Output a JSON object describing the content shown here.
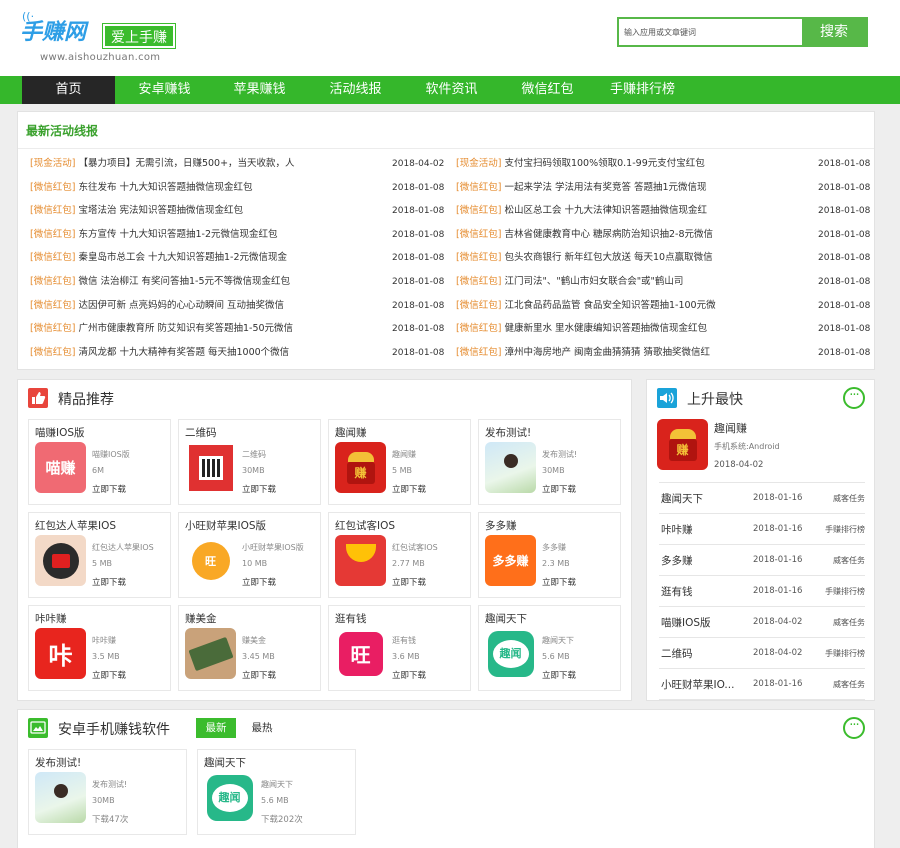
{
  "header": {
    "logo_text": "手赚网",
    "logo_tag": "爱上手赚",
    "logo_url": "www.aishouzhuan.com",
    "search_placeholder": "输入应用或文章键词",
    "search_button": "搜索"
  },
  "nav": [
    "首页",
    "安卓赚钱",
    "苹果赚钱",
    "活动线报",
    "软件资讯",
    "微信红包",
    "手赚排行榜"
  ],
  "news": {
    "title": "最新活动线报",
    "left": [
      {
        "cat": "[现金活动]",
        "text": "【暴力项目】无需引流，日赚500+，当天收款，人",
        "date": "2018-04-02"
      },
      {
        "cat": "[微信红包]",
        "text": "东往发布 十九大知识答题抽微信现金红包",
        "date": "2018-01-08"
      },
      {
        "cat": "[微信红包]",
        "text": "宝塔法治 宪法知识答题抽微信现金红包",
        "date": "2018-01-08"
      },
      {
        "cat": "[微信红包]",
        "text": "东方宣传 十九大知识答题抽1-2元微信现金红包",
        "date": "2018-01-08"
      },
      {
        "cat": "[微信红包]",
        "text": "秦皇岛市总工会 十九大知识答题抽1-2元微信现金",
        "date": "2018-01-08"
      },
      {
        "cat": "[微信红包]",
        "text": "微信 法治柳江 有奖问答抽1-5元不等微信现金红包",
        "date": "2018-01-08"
      },
      {
        "cat": "[微信红包]",
        "text": "达因伊可新 点亮妈妈的心心动瞬间 互动抽奖微信",
        "date": "2018-01-08"
      },
      {
        "cat": "[微信红包]",
        "text": "广州市健康教育所 防艾知识有奖答题抽1-50元微信",
        "date": "2018-01-08"
      },
      {
        "cat": "[微信红包]",
        "text": "清风龙都 十九大精神有奖答题 每天抽1000个微信",
        "date": "2018-01-08"
      }
    ],
    "right": [
      {
        "cat": "[现金活动]",
        "text": "支付宝扫码领取100%领取0.1-99元支付宝红包",
        "date": "2018-01-08"
      },
      {
        "cat": "[微信红包]",
        "text": "一起来学法 学法用法有奖竞答 答题抽1元微信现",
        "date": "2018-01-08"
      },
      {
        "cat": "[微信红包]",
        "text": "松山区总工会 十九大法律知识答题抽微信现金红",
        "date": "2018-01-08"
      },
      {
        "cat": "[微信红包]",
        "text": "吉林省健康教育中心 糖尿病防治知识抽2-8元微信",
        "date": "2018-01-08"
      },
      {
        "cat": "[微信红包]",
        "text": "包头农商银行 新年红包大放送 每天10点赢取微信",
        "date": "2018-01-08"
      },
      {
        "cat": "[微信红包]",
        "text": "江门司法\"、\"鹤山市妇女联合会\"或\"鹤山司",
        "date": "2018-01-08"
      },
      {
        "cat": "[微信红包]",
        "text": "江北食品药品监管 食品安全知识答题抽1-100元微",
        "date": "2018-01-08"
      },
      {
        "cat": "[微信红包]",
        "text": "健康新里水 里水健康编知识答题抽微信现金红包",
        "date": "2018-01-08"
      },
      {
        "cat": "[微信红包]",
        "text": "漳州中海房地产 闽南金曲猜猜猜 猜歌抽奖微信红",
        "date": "2018-01-08"
      }
    ]
  },
  "featured": {
    "title": "精品推荐",
    "download_label": "立即下载",
    "cards": [
      {
        "title": "喵赚IOS版",
        "name": "喵赚IOS版",
        "size": "6M",
        "icon": "miaozhuan-icon"
      },
      {
        "title": "二维码",
        "name": "二维码",
        "size": "30MB",
        "icon": "qrcode-icon"
      },
      {
        "title": "趣闻赚",
        "name": "趣闻赚",
        "size": "5 MB",
        "icon": "quwenzhuan-icon"
      },
      {
        "title": "发布测试!",
        "name": "发布测试!",
        "size": "30MB",
        "icon": "photo-icon"
      },
      {
        "title": "红包达人苹果IOS",
        "name": "红包达人苹果IOS",
        "size": "5 MB",
        "icon": "hongbao-daren-icon"
      },
      {
        "title": "小旺财苹果IOS版",
        "name": "小旺财苹果IOS版",
        "size": "10 MB",
        "icon": "xiaowangcai-icon"
      },
      {
        "title": "红包试客IOS",
        "name": "红包试客IOS",
        "size": "2.77 MB",
        "icon": "hongbao-shike-icon"
      },
      {
        "title": "多多赚",
        "name": "多多赚",
        "size": "2.3 MB",
        "icon": "duoduozhuan-icon"
      },
      {
        "title": "咔咔赚",
        "name": "咔咔赚",
        "size": "3.5 MB",
        "icon": "kakazhuan-icon"
      },
      {
        "title": "赚美金",
        "name": "赚美金",
        "size": "3.45 MB",
        "icon": "zhuanmeijin-icon"
      },
      {
        "title": "逛有钱",
        "name": "逛有钱",
        "size": "3.6 MB",
        "icon": "guangyouqian-icon"
      },
      {
        "title": "趣闻天下",
        "name": "趣闻天下",
        "size": "5.6 MB",
        "icon": "quwentianxia-icon"
      }
    ]
  },
  "rank": {
    "title": "上升最快",
    "top": {
      "name": "趣闻赚",
      "system": "手机系统:Android",
      "date": "2018-04-02"
    },
    "rows": [
      {
        "name": "趣闻天下",
        "date": "2018-01-16",
        "tag": "威客任务"
      },
      {
        "name": "咔咔赚",
        "date": "2018-01-16",
        "tag": "手赚排行榜"
      },
      {
        "name": "多多赚",
        "date": "2018-01-16",
        "tag": "威客任务"
      },
      {
        "name": "逛有钱",
        "date": "2018-01-16",
        "tag": "手赚排行榜"
      },
      {
        "name": "喵赚IOS版",
        "date": "2018-04-02",
        "tag": "威客任务"
      },
      {
        "name": "二维码",
        "date": "2018-04-02",
        "tag": "手赚排行榜"
      },
      {
        "name": "小旺财苹果IO...",
        "date": "2018-01-16",
        "tag": "威客任务"
      }
    ]
  },
  "android": {
    "title": "安卓手机赚钱软件",
    "tabs": [
      "最新",
      "最热"
    ],
    "cards": [
      {
        "title": "发布测试!",
        "name": "发布测试!",
        "size": "30MB",
        "dl": "下载47次",
        "icon": "photo-icon"
      },
      {
        "title": "趣闻天下",
        "name": "趣闻天下",
        "size": "5.6 MB",
        "dl": "下载202次",
        "icon": "quwentianxia-icon"
      }
    ]
  },
  "colors": {
    "brand_green": "#35b72b",
    "nav_active": "#262626",
    "category_orange": "#e58b2e",
    "logo_blue": "#2e9ee6"
  }
}
